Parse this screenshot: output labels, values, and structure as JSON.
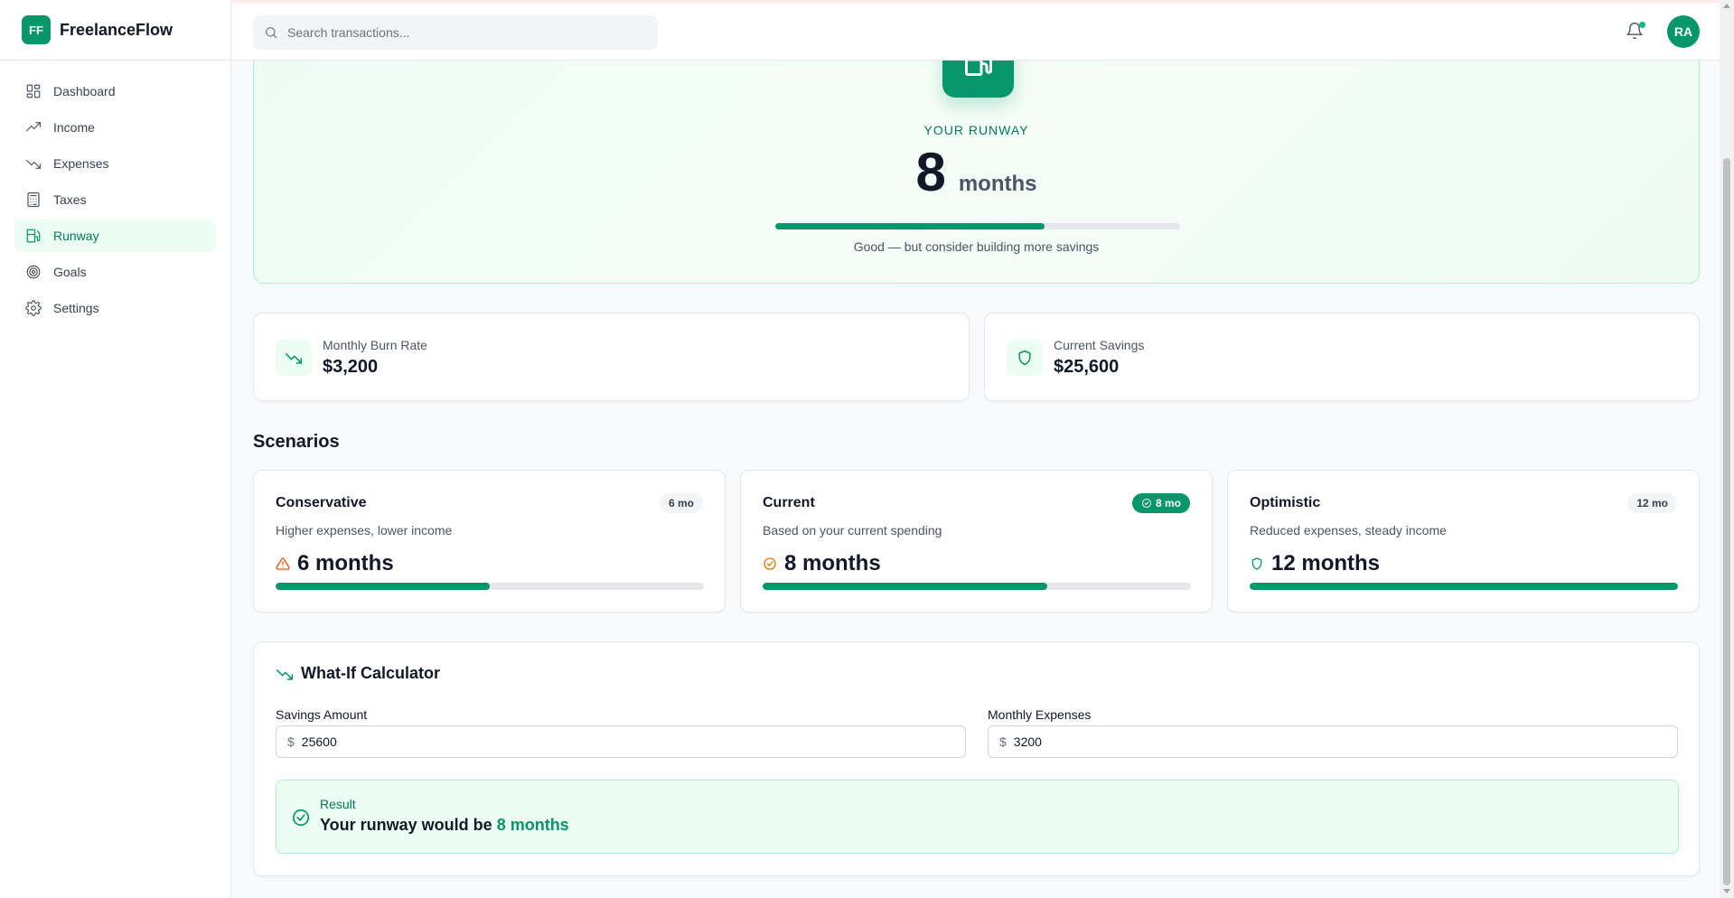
{
  "app": {
    "logo": "FF",
    "name": "FreelanceFlow"
  },
  "search": {
    "placeholder": "Search transactions..."
  },
  "user": {
    "initials": "RA",
    "has_notification": true
  },
  "sidebar": {
    "items": [
      {
        "label": "Dashboard",
        "icon": "dashboard-icon"
      },
      {
        "label": "Income",
        "icon": "trending-up-icon"
      },
      {
        "label": "Expenses",
        "icon": "trending-down-icon"
      },
      {
        "label": "Taxes",
        "icon": "calculator-icon"
      },
      {
        "label": "Runway",
        "icon": "fuel-icon",
        "active": true
      },
      {
        "label": "Goals",
        "icon": "target-icon"
      },
      {
        "label": "Settings",
        "icon": "gear-icon"
      }
    ]
  },
  "runway": {
    "label": "YOUR RUNWAY",
    "value": "8",
    "unit": "months",
    "progress": 0.665,
    "note": "Good — but consider building more savings"
  },
  "stats": [
    {
      "label": "Monthly Burn Rate",
      "value": "$3,200",
      "icon": "trending-down-icon"
    },
    {
      "label": "Current Savings",
      "value": "$25,600",
      "icon": "shield-icon"
    }
  ],
  "scenarios_title": "Scenarios",
  "scenarios": [
    {
      "name": "Conservative",
      "badge": "6 mo",
      "desc": "Higher expenses, lower income",
      "result": "6 months",
      "icon": "warning-icon",
      "progress": 0.5,
      "active": false
    },
    {
      "name": "Current",
      "badge": "8 mo",
      "desc": "Based on your current spending",
      "result": "8 months",
      "icon": "check-circle-icon",
      "progress": 0.665,
      "active": true
    },
    {
      "name": "Optimistic",
      "badge": "12 mo",
      "desc": "Reduced expenses, steady income",
      "result": "12 months",
      "icon": "shield-icon",
      "progress": 1.0,
      "active": false
    }
  ],
  "calculator": {
    "title": "What-If Calculator",
    "savings_label": "Savings Amount",
    "savings_value": "25600",
    "expenses_label": "Monthly Expenses",
    "expenses_value": "3200",
    "currency": "$",
    "result_label": "Result",
    "result_prefix": "Your runway would be ",
    "result_value": "8 months"
  },
  "colors": {
    "accent": "#079669",
    "accent_light": "#ecfdf4",
    "warning": "#ea580c",
    "check": "#d97706"
  }
}
